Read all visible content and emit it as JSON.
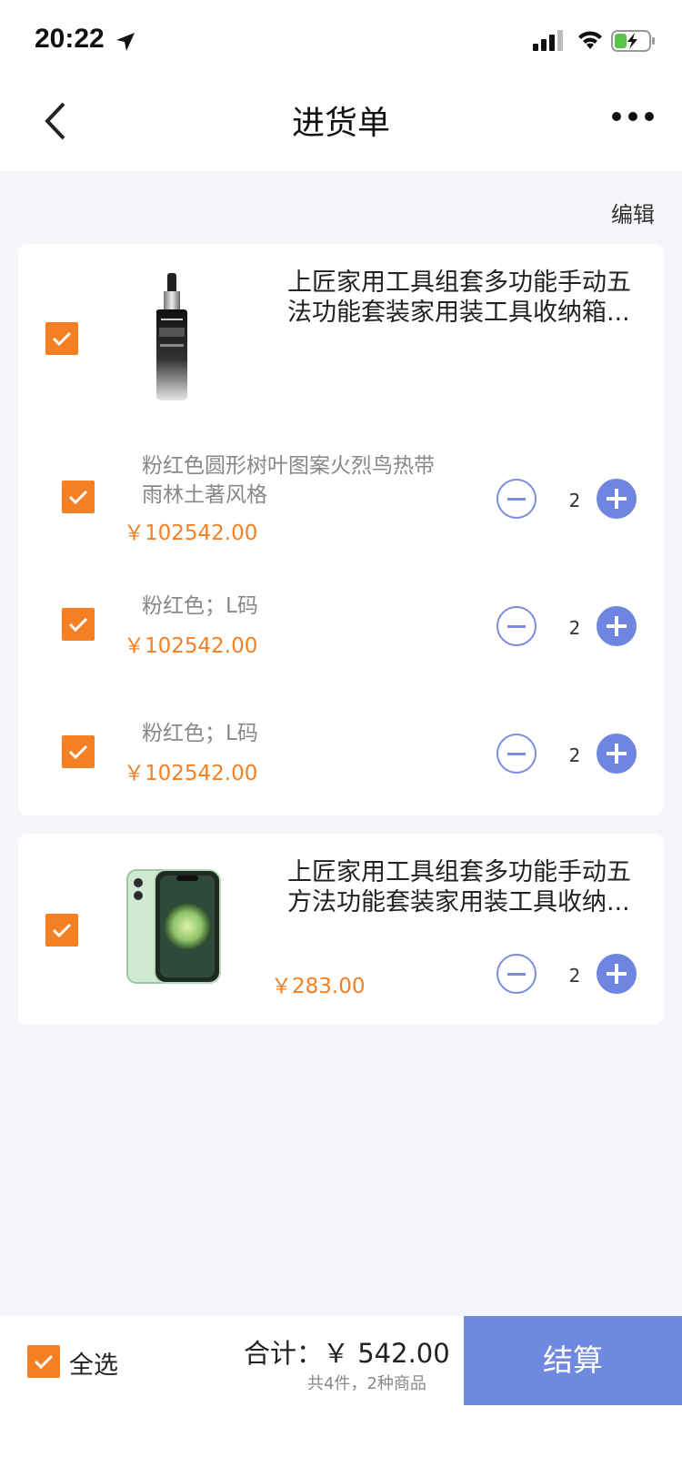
{
  "status_bar": {
    "time": "20:22"
  },
  "nav": {
    "title": "进货单"
  },
  "edit_label": "编辑",
  "groups": [
    {
      "title_line1": "上匠家用工具组套多功能手动五",
      "title_line2": "法功能套装家用装工具收纳箱...",
      "thumb": "serum-bottle-image",
      "skus": [
        {
          "spec": "粉红色圆形树叶图案火烈鸟热带雨林土著风格",
          "price": "￥102542.00",
          "qty": "2"
        },
        {
          "spec": "粉红色；L码",
          "price": "￥102542.00",
          "qty": "2"
        },
        {
          "spec": "粉红色；L码",
          "price": "￥102542.00",
          "qty": "2"
        }
      ]
    },
    {
      "title_line1": "上匠家用工具组套多功能手动五",
      "title_line2": "方法功能套装家用装工具收纳...",
      "thumb": "phone-image",
      "price": "￥283.00",
      "qty": "2"
    }
  ],
  "footer": {
    "select_all": "全选",
    "total": "合计：￥ 542.00",
    "summary": "共4件，2种商品",
    "checkout": "结算"
  },
  "colors": {
    "accent": "#f58024",
    "brand": "#7089e0"
  }
}
